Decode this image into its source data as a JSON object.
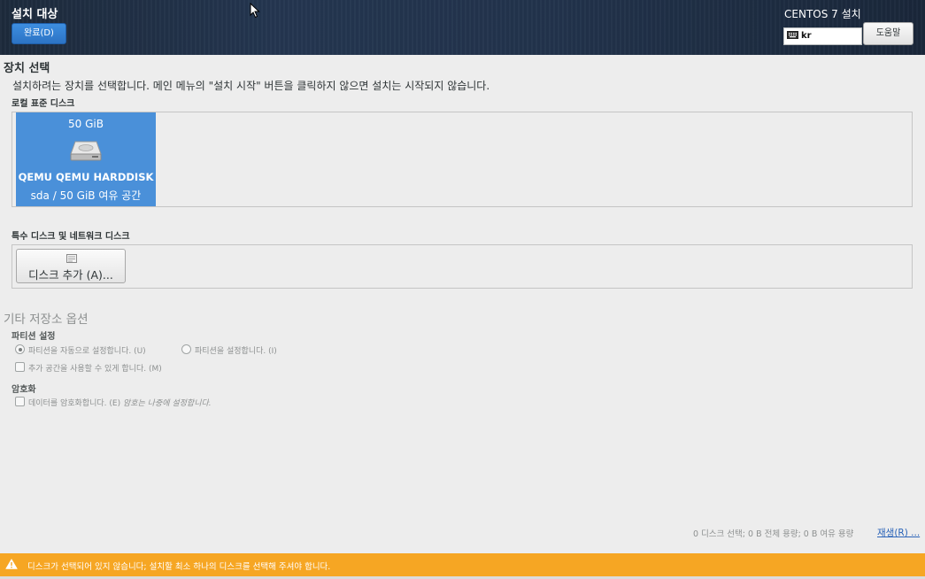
{
  "header": {
    "title": "설치 대상",
    "done_button": "완료(D)",
    "product_title": "CENTOS 7 설치",
    "keyboard_layout": "kr",
    "help_button": "도움말"
  },
  "storage": {
    "title": "장치 선택",
    "description": "설치하려는 장치를 선택합니다. 메인 메뉴의 \"설치 시작\" 버튼을 클릭하지 않으면 설치는 시작되지 않습니다.",
    "local_disks_heading": "로컬 표준 디스크",
    "disk": {
      "size": "50 GiB",
      "name": "QEMU QEMU HARDDISK",
      "free": "sda  /  50 GiB 여유 공간"
    },
    "special_disks_heading": "특수 디스크 및 네트워크 디스크",
    "add_disk_button": "디스크 추가 (A)..."
  },
  "other": {
    "title": "기타 저장소 옵션",
    "partition_label": "파티션 설정",
    "auto_partition": "파티션을 자동으로 설정합니다. (U)",
    "manual_partition": "파티션을 설정합니다. (I)",
    "extra_space": "추가 공간을 사용할 수 있게 합니다. (M)",
    "encryption_label": "암호화",
    "encrypt_data": "데이터를 암호화합니다. (E)",
    "encrypt_note": "암호는 나중에 설정합니다."
  },
  "footer": {
    "summary": "0 디스크 선택; 0 B 전체 용량; 0 B 여유 용량",
    "refresh_link": "재생(R) ...",
    "warning": "디스크가 선택되어 있지 않습니다; 설치할 최소 하나의 디스크를 선택해 주셔야 합니다."
  },
  "colors": {
    "accent": "#4a90d9",
    "warning": "#f6a623",
    "header_bg": "#22334c"
  }
}
